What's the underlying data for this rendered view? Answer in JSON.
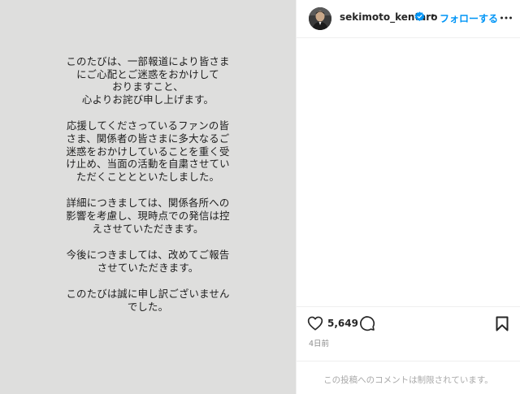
{
  "statement": {
    "paragraphs": [
      [
        "このたびは、一部報道により皆さま",
        "にご心配とご迷惑をおかけして",
        "おりますこと、",
        "心よりお詫び申し上げます。"
      ],
      [
        "応援してくださっているファンの皆",
        "さま、関係者の皆さまに多大なるご",
        "迷惑をおかけしていることを重く受",
        "け止め、当面の活動を自粛させてい",
        "ただくこととといたしました。"
      ],
      [
        "詳細につきましては、関係各所への",
        "影響を考慮し、現時点での発信は控",
        "えさせていただきます。"
      ],
      [
        "今後につきましては、改めてご報告",
        "させていただきます。"
      ],
      [
        "このたびは誠に申し訳ございません",
        "でした。"
      ]
    ]
  },
  "header": {
    "username": "sekimoto_kentaro",
    "follow_label": "フォローする",
    "separator": "•",
    "verified_icon": "verified-badge-icon",
    "more_icon": "more-options-icon"
  },
  "actions": {
    "likes": "5,649",
    "heart_icon": "heart-icon",
    "comment_icon": "comment-icon",
    "save_icon": "bookmark-icon"
  },
  "meta": {
    "timestamp": "4日前",
    "comments_restricted": "この投稿へのコメントは制限されています。"
  },
  "colors": {
    "accent": "#0095f6",
    "image_background": "#dededd",
    "muted_text": "#8e8e8e"
  }
}
